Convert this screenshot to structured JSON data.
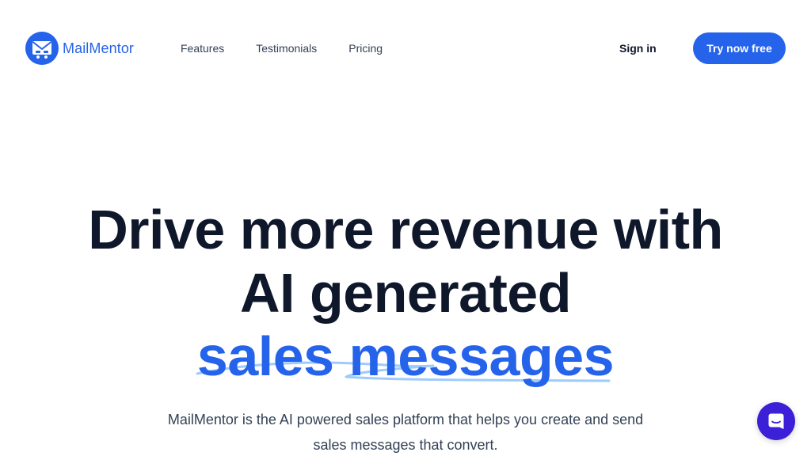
{
  "brand": {
    "name": "MailMentor",
    "icon": "envelope-icon",
    "color": "#2563eb"
  },
  "nav": {
    "items": [
      {
        "label": "Features"
      },
      {
        "label": "Testimonials"
      },
      {
        "label": "Pricing"
      }
    ]
  },
  "auth": {
    "sign_in_label": "Sign in",
    "cta_label": "Try now free",
    "cta_color": "#2563eb"
  },
  "hero": {
    "title_line1": "Drive more revenue with",
    "title_line2": "AI generated",
    "title_accent": "sales messages",
    "subtitle_line1": "MailMentor is the AI powered sales platform that helps you create and send",
    "subtitle_line2": "sales messages that convert."
  },
  "chat_widget": {
    "icon": "chat-icon",
    "color": "#3b20d8"
  }
}
